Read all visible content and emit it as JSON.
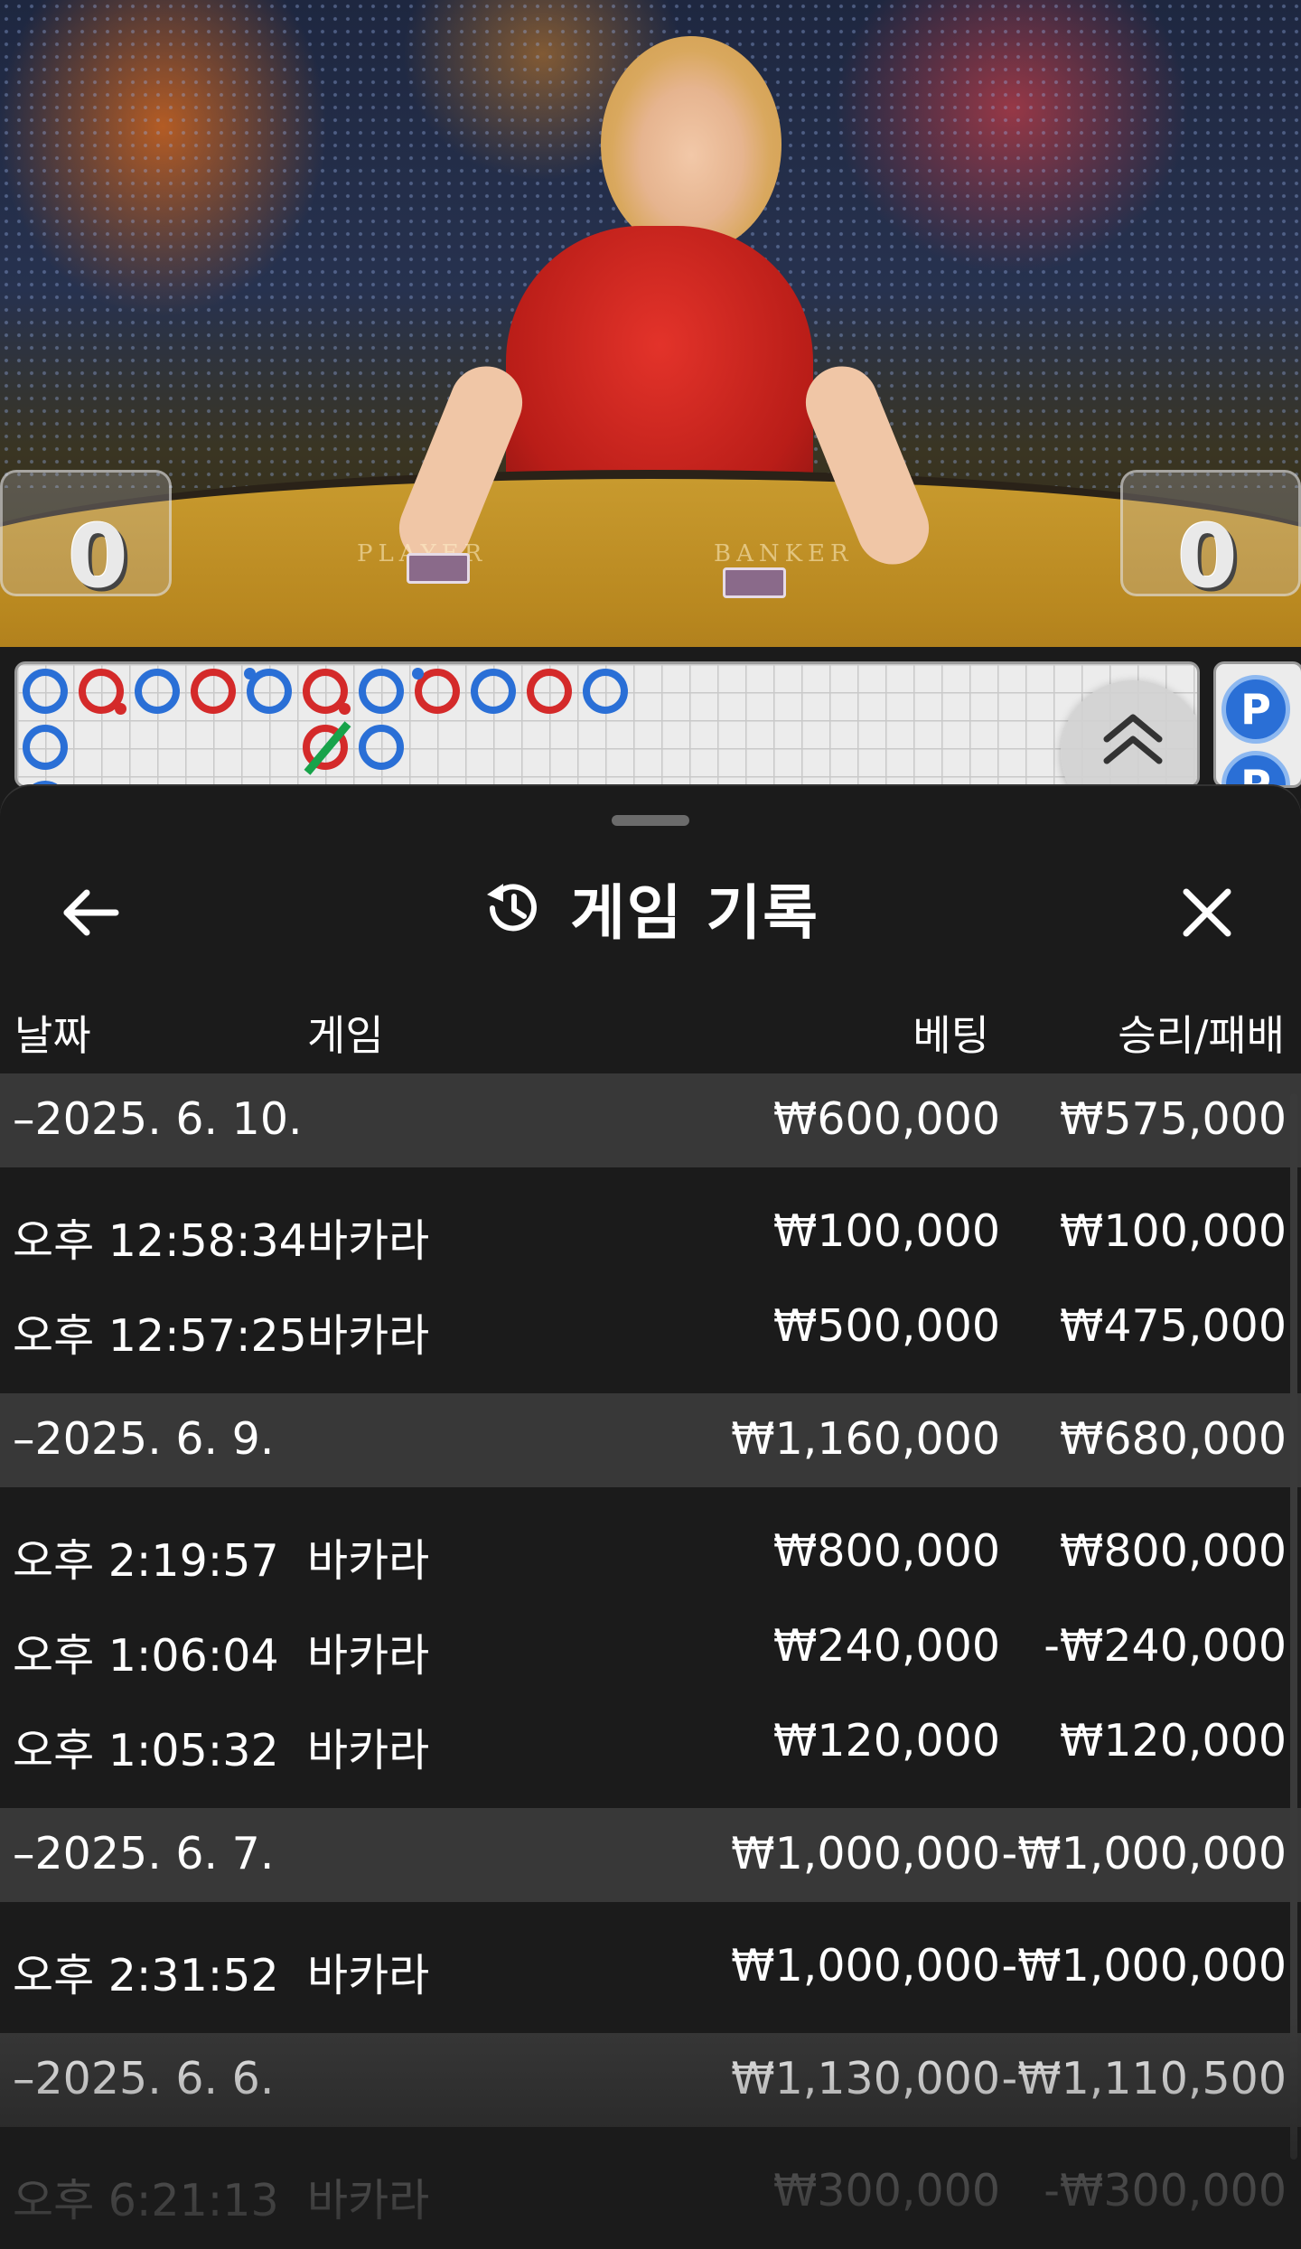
{
  "video": {
    "player_score": "0",
    "banker_score": "0",
    "player_label": "PLAYER",
    "banker_label": "BANKER"
  },
  "roadmap": {
    "side_label": "P",
    "colors": {
      "player": "#2a6fd6",
      "banker": "#d42a2a",
      "tie": "#17a34a"
    }
  },
  "sheet": {
    "title": "게임 기록",
    "title_icon": "history-icon",
    "back_icon": "arrow-left-icon",
    "close_icon": "close-icon",
    "columns": {
      "date": "날짜",
      "game": "게임",
      "bet": "베팅",
      "win_loss": "승리/패배"
    },
    "groups": [
      {
        "date": "–2025. 6. 10.",
        "bet": "₩600,000",
        "win_loss": "₩575,000",
        "entries": [
          {
            "time": "오후 12:58:34",
            "game": "바카라",
            "bet": "₩100,000",
            "win_loss": "₩100,000"
          },
          {
            "time": "오후 12:57:25",
            "game": "바카라",
            "bet": "₩500,000",
            "win_loss": "₩475,000"
          }
        ]
      },
      {
        "date": "–2025. 6. 9.",
        "bet": "₩1,160,000",
        "win_loss": "₩680,000",
        "entries": [
          {
            "time": "오후 2:19:57",
            "game": "바카라",
            "bet": "₩800,000",
            "win_loss": "₩800,000"
          },
          {
            "time": "오후 1:06:04",
            "game": "바카라",
            "bet": "₩240,000",
            "win_loss": "-₩240,000"
          },
          {
            "time": "오후 1:05:32",
            "game": "바카라",
            "bet": "₩120,000",
            "win_loss": "₩120,000"
          }
        ]
      },
      {
        "date": "–2025. 6. 7.",
        "bet": "₩1,000,000",
        "win_loss": "-₩1,000,000",
        "entries": [
          {
            "time": "오후 2:31:52",
            "game": "바카라",
            "bet": "₩1,000,000",
            "win_loss": "-₩1,000,000"
          }
        ]
      },
      {
        "date": "–2025. 6. 6.",
        "bet": "₩1,130,000",
        "win_loss": "-₩1,110,500",
        "entries": [
          {
            "time": "오후 6:21:13",
            "game": "바카라",
            "bet": "₩300,000",
            "win_loss": "-₩300,000"
          }
        ]
      }
    ]
  }
}
